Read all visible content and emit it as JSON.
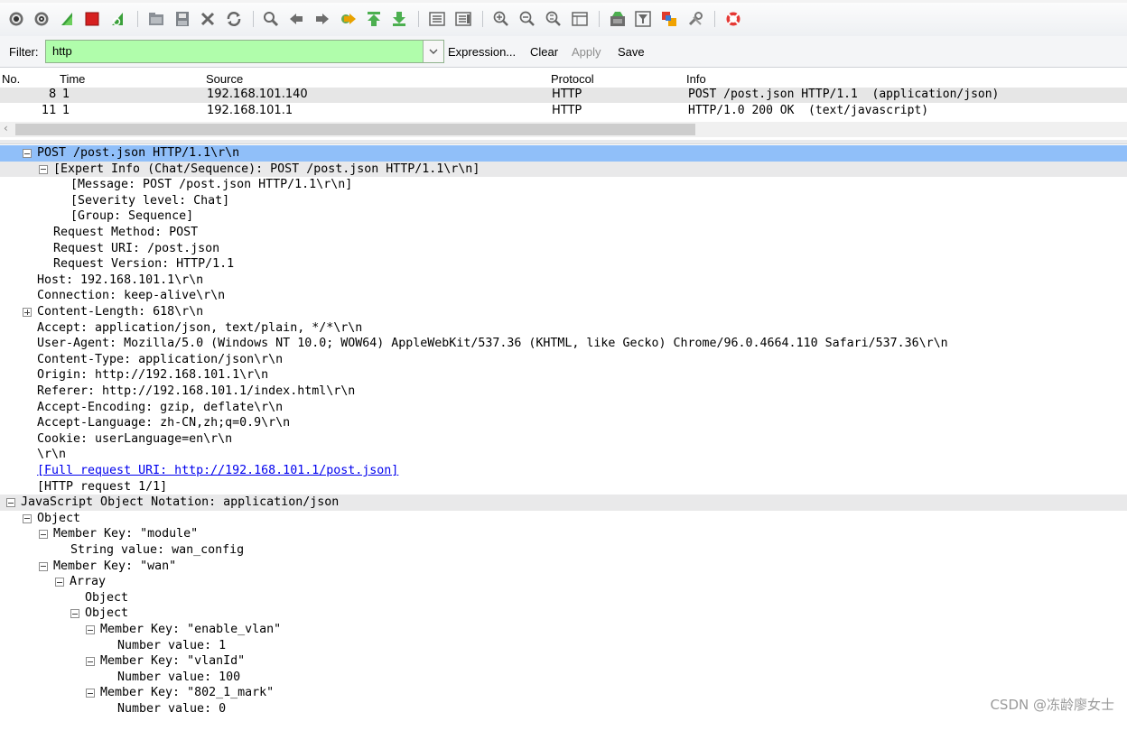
{
  "filter": {
    "label": "Filter:",
    "value": "http",
    "expression_label": "Expression...",
    "clear_label": "Clear",
    "apply_label": "Apply",
    "save_label": "Save",
    "valid_color": "#b0fdab"
  },
  "packet_list": {
    "columns": [
      "No.",
      "Time",
      "Source",
      "Protocol",
      "Info"
    ],
    "rows": [
      {
        "no": "8",
        "time": "1",
        "source": "192.168.101.140",
        "protocol": "HTTP",
        "info": "POST /post.json HTTP/1.1  (application/json)"
      },
      {
        "no": "11",
        "time": "1",
        "source": "192.168.101.1",
        "protocol": "HTTP",
        "info": "HTTP/1.0 200 OK  (text/javascript)"
      }
    ]
  },
  "details": {
    "lines": [
      "POST /post.json HTTP/1.1\\r\\n",
      "[Expert Info (Chat/Sequence): POST /post.json HTTP/1.1\\r\\n]",
      "[Message: POST /post.json HTTP/1.1\\r\\n]",
      "[Severity level: Chat]",
      "[Group: Sequence]",
      "Request Method: POST",
      "Request URI: /post.json",
      "Request Version: HTTP/1.1",
      "Host: 192.168.101.1\\r\\n",
      "Connection: keep-alive\\r\\n",
      "Content-Length: 618\\r\\n",
      "Accept: application/json, text/plain, */*\\r\\n",
      "User-Agent: Mozilla/5.0 (Windows NT 10.0; WOW64) AppleWebKit/537.36 (KHTML, like Gecko) Chrome/96.0.4664.110 Safari/537.36\\r\\n",
      "Content-Type: application/json\\r\\n",
      "Origin: http://192.168.101.1\\r\\n",
      "Referer: http://192.168.101.1/index.html\\r\\n",
      "Accept-Encoding: gzip, deflate\\r\\n",
      "Accept-Language: zh-CN,zh;q=0.9\\r\\n",
      "Cookie: userLanguage=en\\r\\n",
      "\\r\\n",
      "[Full request URI: http://192.168.101.1/post.json]",
      "[HTTP request 1/1]",
      "JavaScript Object Notation: application/json",
      "Object",
      "Member Key: \"module\"",
      "String value: wan_config",
      "Member Key: \"wan\"",
      "Array",
      "Object",
      "Object",
      "Member Key: \"enable_vlan\"",
      "Number value: 1",
      "Member Key: \"vlanId\"",
      "Number value: 100",
      "Member Key: \"802_1_mark\"",
      "Number value: 0"
    ]
  },
  "watermark": "CSDN @冻龄廖女士",
  "icons": [
    "interface-list-icon",
    "capture-options-icon",
    "start-capture-icon",
    "stop-capture-icon",
    "restart-capture-icon",
    "open-file-icon",
    "save-file-icon",
    "close-file-icon",
    "reload-icon",
    "find-packet-icon",
    "go-back-icon",
    "go-forward-icon",
    "go-to-packet-icon",
    "go-first-icon",
    "go-last-icon",
    "colorize-icon",
    "autoscroll-icon",
    "zoom-in-icon",
    "zoom-out-icon",
    "zoom-normal-icon",
    "resize-columns-icon",
    "capture-filters-icon",
    "display-filters-icon",
    "coloring-rules-icon",
    "preferences-icon",
    "help-icon"
  ]
}
